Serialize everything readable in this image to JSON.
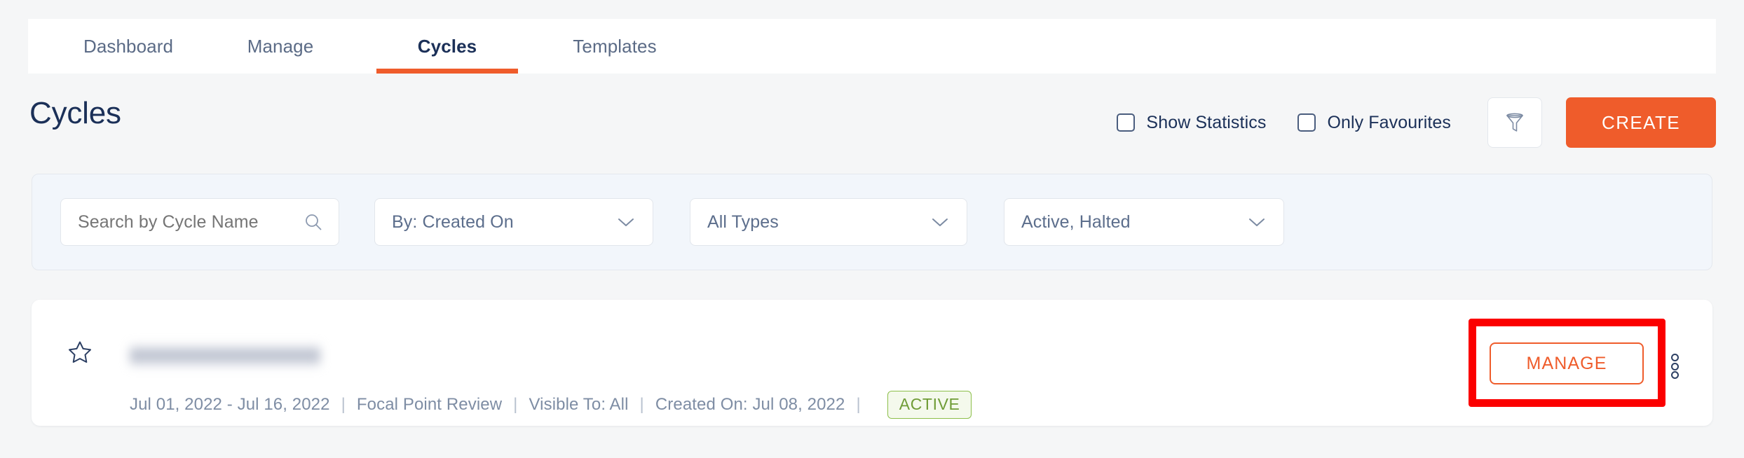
{
  "nav": {
    "tabs": [
      {
        "label": "Dashboard",
        "active": false
      },
      {
        "label": "Manage",
        "active": false
      },
      {
        "label": "Cycles",
        "active": true
      },
      {
        "label": "Templates",
        "active": false
      }
    ]
  },
  "header": {
    "title": "Cycles",
    "checkboxes": [
      {
        "label": "Show Statistics",
        "checked": false
      },
      {
        "label": "Only Favourites",
        "checked": false
      }
    ],
    "filter_icon": "funnel-icon",
    "create_label": "CREATE"
  },
  "filters": {
    "search": {
      "placeholder": "Search by Cycle Name",
      "value": "",
      "icon": "search-icon"
    },
    "sort_by": {
      "value": "By: Created On",
      "icon": "chevron-down-icon"
    },
    "types": {
      "value": "All Types",
      "icon": "chevron-down-icon"
    },
    "status": {
      "value": "Active, Halted",
      "icon": "chevron-down-icon"
    }
  },
  "cycle": {
    "favourite_icon": "star-outline-icon",
    "name": "",
    "name_redacted": true,
    "date_range": "Jul 01, 2022 - Jul 16, 2022",
    "separator": "|",
    "type": "Focal Point Review",
    "visible_to": "Visible To:  All",
    "created_on": "Created On: Jul 08, 2022",
    "status": "ACTIVE",
    "manage_label": "MANAGE",
    "kebab_icon": "more-vertical-icon"
  },
  "annotation": {
    "color": "#fb0000",
    "target": "manage-button"
  },
  "colors": {
    "accent_orange": "#ef5c2b",
    "navy": "#1b3058",
    "muted": "#7e8da4",
    "status_green": "#6f9c36",
    "page_bg": "#f5f6f7"
  }
}
